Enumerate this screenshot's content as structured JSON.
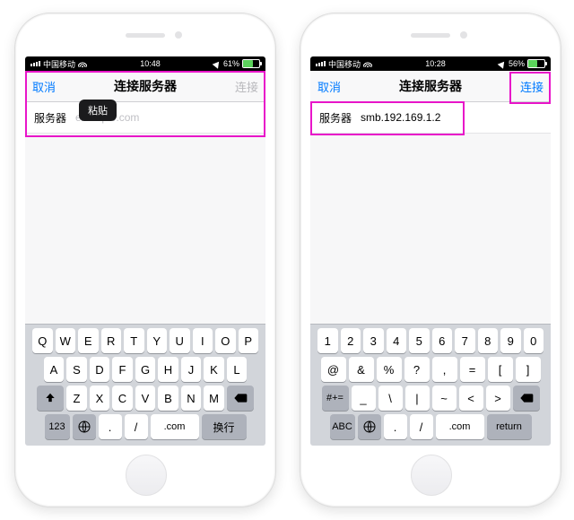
{
  "phones": {
    "left": {
      "statusbar": {
        "carrier": "中国移动",
        "time": "10:48",
        "battery_pct": "61%",
        "battery_fill": "61%"
      },
      "nav": {
        "cancel": "取消",
        "title": "连接服务器",
        "connect": "连接",
        "connect_enabled": false
      },
      "row": {
        "label": "服务器",
        "placeholder": "example.com",
        "value": ""
      },
      "paste_popover": "粘贴",
      "keyboard": {
        "r1": [
          "Q",
          "W",
          "E",
          "R",
          "T",
          "Y",
          "U",
          "I",
          "O",
          "P"
        ],
        "r2": [
          "A",
          "S",
          "D",
          "F",
          "G",
          "H",
          "J",
          "K",
          "L"
        ],
        "r3_mid": [
          "Z",
          "X",
          "C",
          "V",
          "B",
          "N",
          "M"
        ],
        "bottom": {
          "num": "123",
          "dot": ".",
          "slash": "/",
          "com": ".com",
          "ret": "换行"
        }
      }
    },
    "right": {
      "statusbar": {
        "carrier": "中国移动",
        "time": "10:28",
        "battery_pct": "56%",
        "battery_fill": "56%"
      },
      "nav": {
        "cancel": "取消",
        "title": "连接服务器",
        "connect": "连接",
        "connect_enabled": true
      },
      "row": {
        "label": "服务器",
        "value": "smb.192.169.1.2"
      },
      "keyboard": {
        "r1": [
          "1",
          "2",
          "3",
          "4",
          "5",
          "6",
          "7",
          "8",
          "9",
          "0"
        ],
        "r2": [
          "@",
          "&",
          "%",
          "?",
          ",",
          "=",
          "[",
          "]"
        ],
        "r3_mid": [
          "_",
          "\\",
          "|",
          "~",
          "<",
          ">"
        ],
        "bottom": {
          "abc": "ABC",
          "dot": ".",
          "slash": "/",
          "com": ".com",
          "ret": "return"
        }
      }
    }
  },
  "labels": {
    "shift": "shift",
    "backspace": "backspace",
    "globe": "globe"
  }
}
